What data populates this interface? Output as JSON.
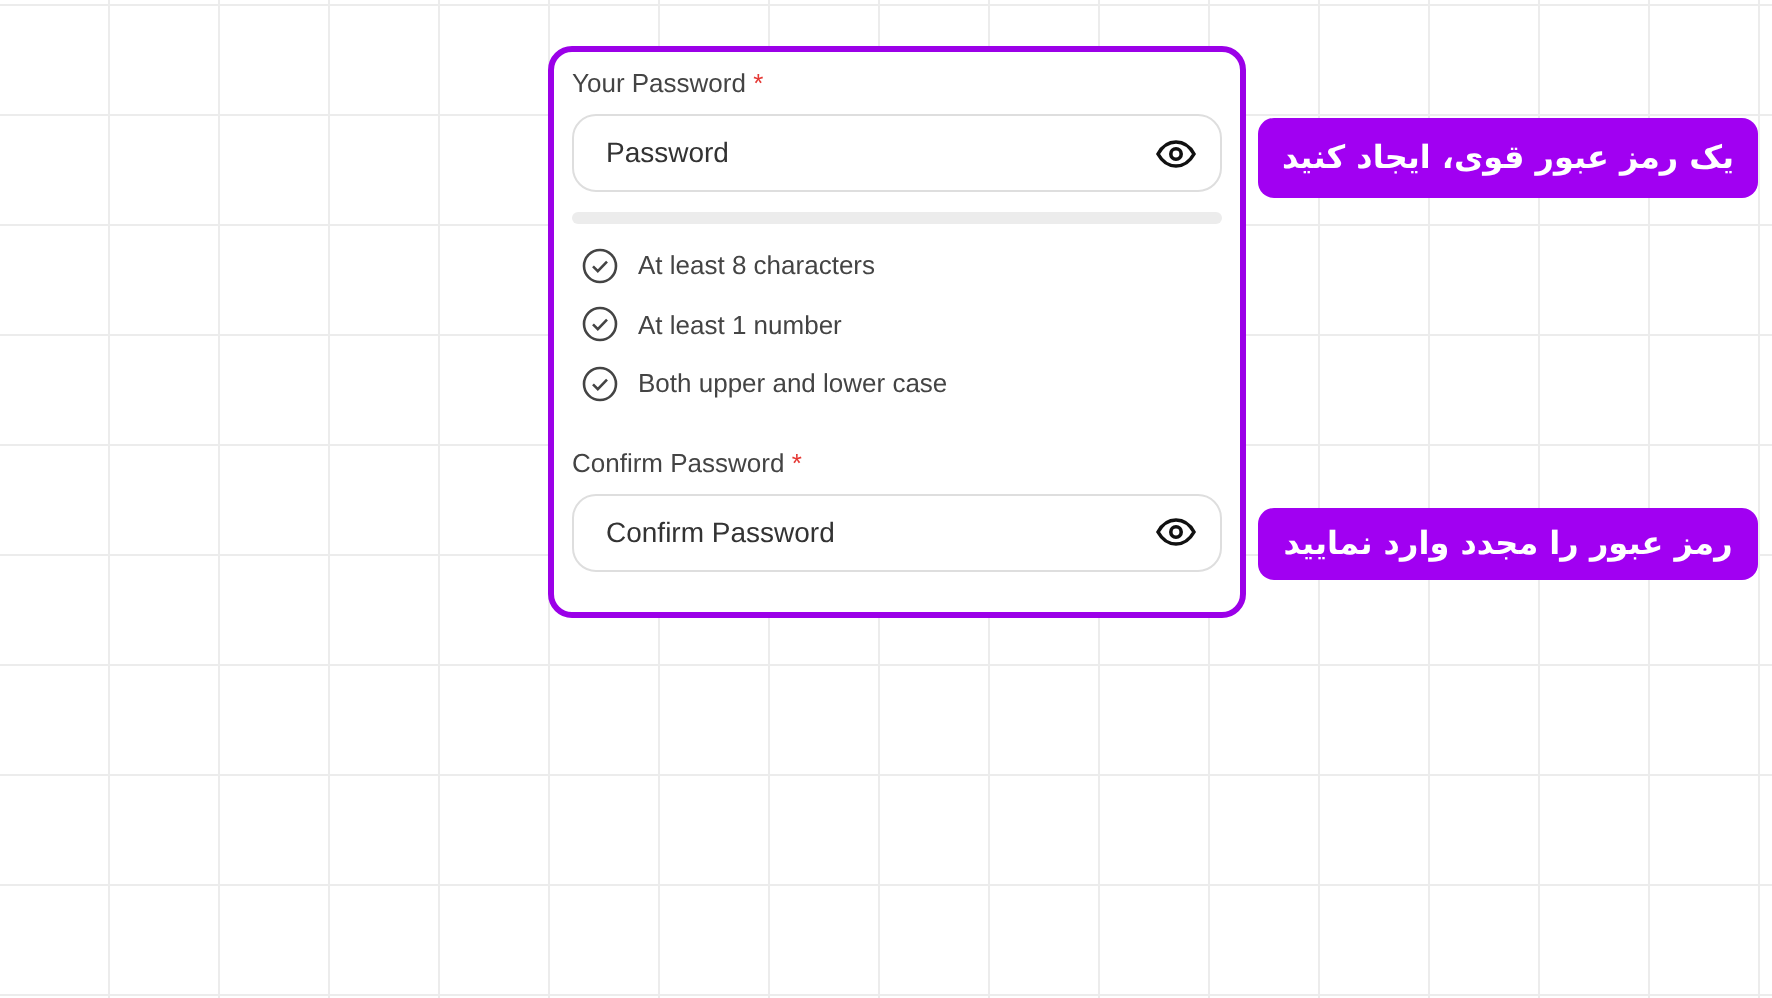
{
  "form": {
    "fields": [
      {
        "label": "Your Password",
        "required_mark": "*",
        "placeholder": "Password",
        "strength": {
          "level": 0
        },
        "requirements": [
          "At least 8 characters",
          "At least 1 number",
          "Both upper and lower case"
        ]
      },
      {
        "label": "Confirm Password",
        "required_mark": "*",
        "placeholder": "Confirm Password"
      }
    ]
  },
  "annotations": [
    "یک رمز عبور قوی، ایجاد کنید",
    "رمز عبور را مجدد وارد نمایید"
  ]
}
